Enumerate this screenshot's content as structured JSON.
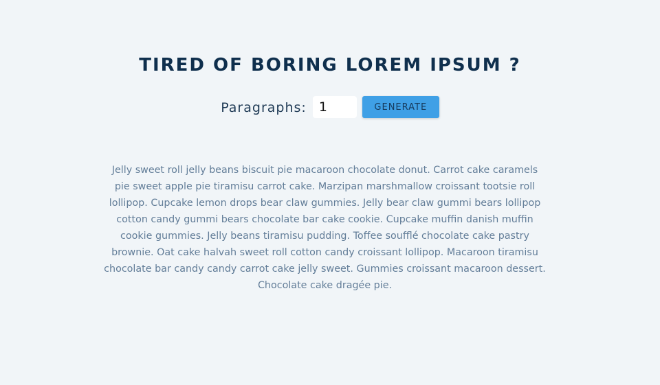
{
  "header": {
    "title": "TIRED OF BORING LOREM IPSUM ?"
  },
  "form": {
    "label": "Paragraphs:",
    "amount_value": "1",
    "generate_label": "GENERATE"
  },
  "content": {
    "paragraphs": [
      "Jelly sweet roll jelly beans biscuit pie macaroon chocolate donut. Carrot cake caramels pie sweet apple pie tiramisu carrot cake. Marzipan marshmallow croissant tootsie roll lollipop. Cupcake lemon drops bear claw gummies. Jelly bear claw gummi bears lollipop cotton candy gummi bears chocolate bar cake cookie. Cupcake muffin danish muffin cookie gummies. Jelly beans tiramisu pudding. Toffee soufflé chocolate cake pastry brownie. Oat cake halvah sweet roll cotton candy croissant lollipop. Macaroon tiramisu chocolate bar candy candy carrot cake jelly sweet. Gummies croissant macaroon dessert. Chocolate cake dragée pie."
    ]
  },
  "colors": {
    "background": "#f1f5f8",
    "title": "#0f2f4d",
    "button": "#3fa0e6",
    "text": "#627d98"
  }
}
